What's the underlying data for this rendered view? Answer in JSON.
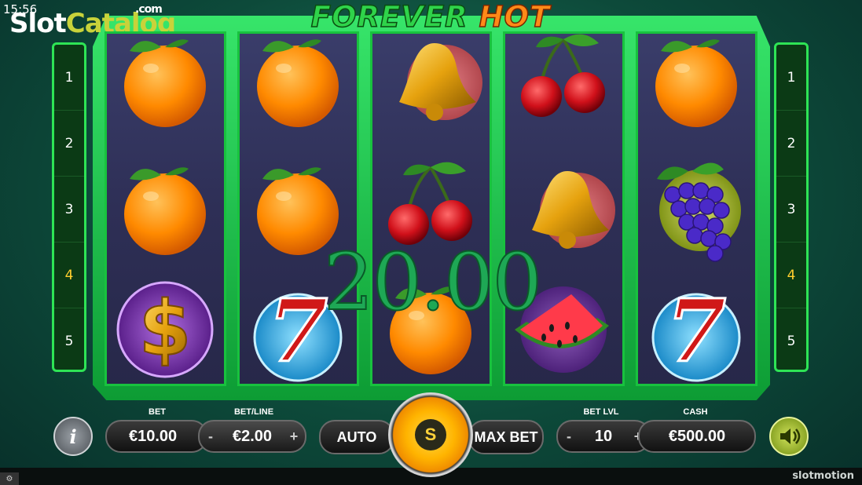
{
  "status_time": "15:56",
  "watermark": {
    "slot": "Slot",
    "catalog": "Catalog",
    "com": ".com"
  },
  "game_title": {
    "part1": "FOREVER",
    "part2": "HOT"
  },
  "paylines_left": [
    "1",
    "2",
    "3",
    "4",
    "5"
  ],
  "paylines_right": [
    "1",
    "2",
    "3",
    "4",
    "5"
  ],
  "highlighted_line": "4",
  "reels": [
    [
      "orange-icon",
      "orange-icon",
      "dollar-icon"
    ],
    [
      "orange-icon",
      "orange-icon",
      "seven-icon"
    ],
    [
      "bell-icon",
      "cherry-icon",
      "orange-icon"
    ],
    [
      "cherry-icon",
      "bell-icon",
      "watermelon-icon"
    ],
    [
      "orange-icon",
      "grapes-icon",
      "seven-icon"
    ]
  ],
  "win_amount": "20.00",
  "controls": {
    "bet_label": "BET",
    "bet_value": "€10.00",
    "betline_label": "BET/LINE",
    "betline_value": "€2.00",
    "auto_label": "AUTO",
    "spin_symbol": "S",
    "maxbet_label": "MAX BET",
    "betlvl_label": "BET LVL",
    "betlvl_value": "10",
    "cash_label": "CASH",
    "cash_value": "€500.00",
    "minus": "-",
    "plus": "+",
    "info": "i"
  },
  "provider": "slotmotion",
  "colors": {
    "accent": "#2ee455",
    "win": "#1ea855",
    "gold": "#ffb400"
  }
}
